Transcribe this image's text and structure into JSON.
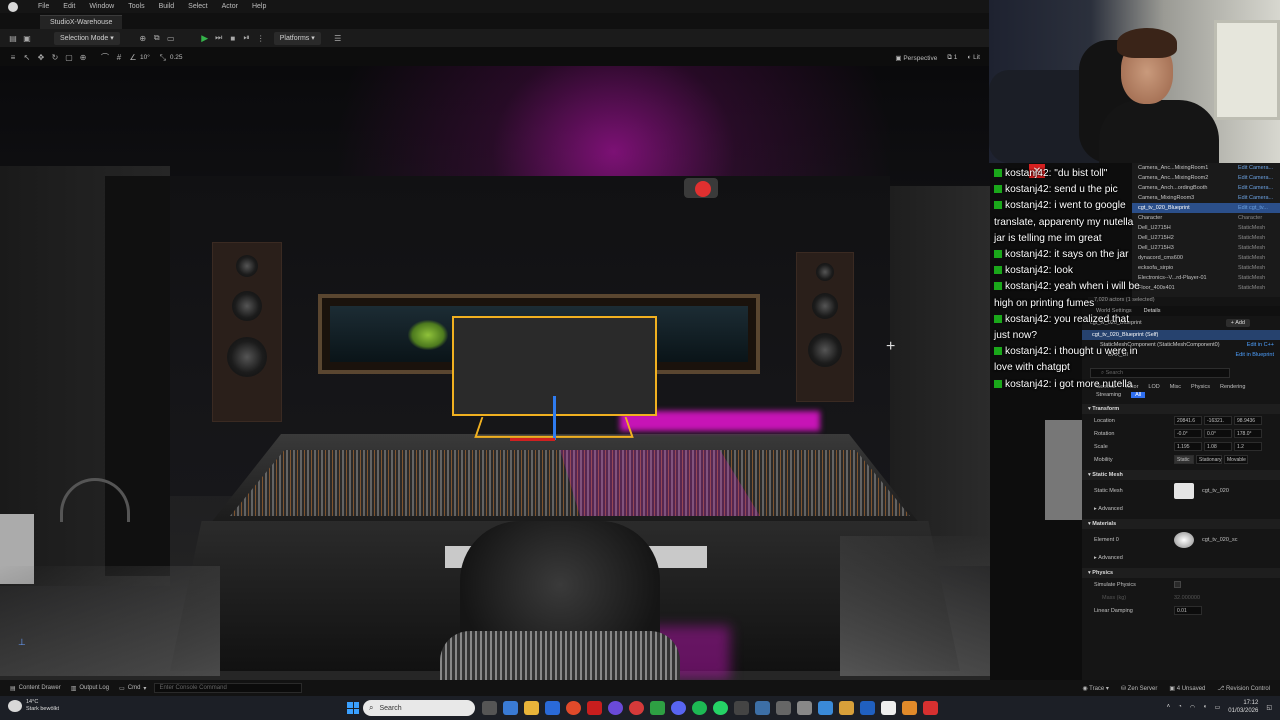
{
  "menubar": {
    "items": [
      "File",
      "Edit",
      "Window",
      "Tools",
      "Build",
      "Select",
      "Actor",
      "Help"
    ]
  },
  "tab": {
    "label": "StudioX-Warehouse"
  },
  "toolbar": {
    "selection_mode": "Selection Mode",
    "platforms": "Platforms"
  },
  "viewport_toolbar": {
    "snap_angle": "10°",
    "scale_snap": "0.25",
    "perspective": "Perspective",
    "count": "1",
    "lit": "Lit"
  },
  "chat": {
    "messages": [
      {
        "user": "kostanj42",
        "text": "\"du bist toll\""
      },
      {
        "user": "kostanj42",
        "text": "send u the pic"
      },
      {
        "user": "kostanj42",
        "text": "i went to google translate, apparenty my nutella jar is telling me im great"
      },
      {
        "user": "kostanj42",
        "text": "it says on the jar"
      },
      {
        "user": "kostanj42",
        "text": "look"
      },
      {
        "user": "kostanj42",
        "text": "yeah when i will be high on printing fumes"
      },
      {
        "user": "kostanj42",
        "text": "you realized that just now?"
      },
      {
        "user": "kostanj42",
        "text": "i thought u were in love with chatgpt"
      },
      {
        "user": "kostanj42",
        "text": "i got more nutella"
      }
    ]
  },
  "outliner": {
    "rows": [
      {
        "name": "Camera_Anc...MixingRoom1",
        "type": "Edit Camera..."
      },
      {
        "name": "Camera_Anc...MixingRoom2",
        "type": "Edit Camera..."
      },
      {
        "name": "Camera_Anch...ordingBooth",
        "type": "Edit Camera..."
      },
      {
        "name": "Camera_MixingRoom3",
        "type": "Edit Camera..."
      },
      {
        "name": "cgt_tv_020_Blueprint",
        "type": "Edit cgt_tv..."
      },
      {
        "name": "Character",
        "type": "Character"
      },
      {
        "name": "Dell_U2715H",
        "type": "StaticMesh"
      },
      {
        "name": "Dell_U2715H2",
        "type": "StaticMesh"
      },
      {
        "name": "Dell_U2715H3",
        "type": "StaticMesh"
      },
      {
        "name": "dynacord_cms600",
        "type": "StaticMesh"
      },
      {
        "name": "ecksofa_sirpio",
        "type": "StaticMesh"
      },
      {
        "name": "Electronics--V...rd-Player-01",
        "type": "StaticMesh"
      },
      {
        "name": "Floor_400x401",
        "type": "StaticMesh"
      }
    ],
    "selected_index": 4,
    "footer": "7,020 actors (1 selected)"
  },
  "details": {
    "tabs": [
      "World Settings",
      "Details"
    ],
    "actor_name": "cgt_tv_020_Blueprint",
    "add_label": "+ Add",
    "components": [
      {
        "name": "cgt_tv_020_Blueprint (Self)",
        "link": ""
      },
      {
        "name": "StaticMeshComponent (StaticMeshComponent0)",
        "link": "Edit in C++"
      },
      {
        "name": "DAX_UI",
        "link": ""
      }
    ],
    "edit_blueprint": "Edit in Blueprint",
    "search_placeholder": "Search",
    "filters": [
      "General",
      "Actor",
      "LOD",
      "Misc",
      "Physics",
      "Rendering",
      "Streaming",
      "All"
    ],
    "transform_section": "Transform",
    "location_label": "Location",
    "location": [
      "20841.6",
      "-16321.",
      "98.9436"
    ],
    "rotation_label": "Rotation",
    "rotation": [
      "-0.0°",
      "0.0°",
      "178.0°"
    ],
    "scale_label": "Scale",
    "scale": [
      "1.195",
      "1.08",
      "1.2"
    ],
    "mobility_label": "Mobility",
    "mobility": [
      "Static",
      "Stationary",
      "Movable"
    ],
    "static_mesh_section": "Static Mesh",
    "static_mesh_label": "Static Mesh",
    "static_mesh_value": "cgt_tv_020",
    "advanced_label": "Advanced",
    "materials_section": "Materials",
    "element0_label": "Element 0",
    "element0_value": "cgt_tv_020_sc",
    "physics_section": "Physics",
    "simulate_physics": "Simulate Physics",
    "mass_label": "Mass (kg)",
    "mass_value": "32.000000",
    "linear_damping_label": "Linear Damping",
    "linear_damping_value": "0.01"
  },
  "statusbar": {
    "content_drawer": "Content Drawer",
    "output_log": "Output Log",
    "cmd": "Cmd",
    "console_placeholder": "Enter Console Command",
    "trace": "Trace",
    "zen_server": "Zen Server",
    "unsaved": "4 Unsaved",
    "revision_control": "Revision Control"
  },
  "taskbar": {
    "temperature": "14°C",
    "weather": "Stark bewölkt",
    "search_placeholder": "Search",
    "time": "17:12",
    "date": "01/03/2026"
  },
  "colors": {
    "selection_outline": "#f0b020",
    "chat_badge": "#1aa81a",
    "accent_blue": "#2f6ff0",
    "magenta_light": "#e014d0"
  }
}
